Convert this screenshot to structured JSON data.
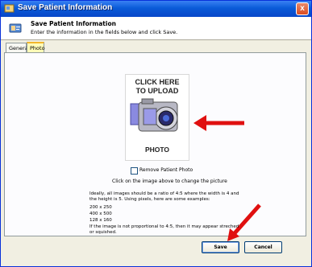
{
  "window": {
    "title": "Save Patient Information",
    "close_label": "x"
  },
  "header": {
    "title": "Save Patient Information",
    "subtitle": "Enter the information in the fields below and click Save."
  },
  "tabs": [
    {
      "label": "General",
      "active": false
    },
    {
      "label": "Photo",
      "active": true
    }
  ],
  "photo": {
    "upload_line1": "CLICK HERE",
    "upload_line2": "TO UPLOAD",
    "caption": "PHOTO"
  },
  "remove_photo": {
    "label": "Remove Patient Photo",
    "checked": false
  },
  "hint": "Click on the image above to change the picture",
  "info": {
    "line1": "Ideally, all images should be a ratio of 4:5 where the width is 4 and",
    "line2": "the height is 5.  Using pixels, here are some examples:",
    "examples": [
      "200 x 250",
      "400 x 500",
      "128 x 160"
    ],
    "line3": "If the image is not proportional to 4:5, then it may appear streched",
    "line4": "or squished."
  },
  "buttons": {
    "save": "Save",
    "cancel": "Cancel"
  },
  "colors": {
    "titlebar": "#0a5bd8",
    "annotation_arrow": "#e01010",
    "active_tab": "#fffbb8"
  }
}
